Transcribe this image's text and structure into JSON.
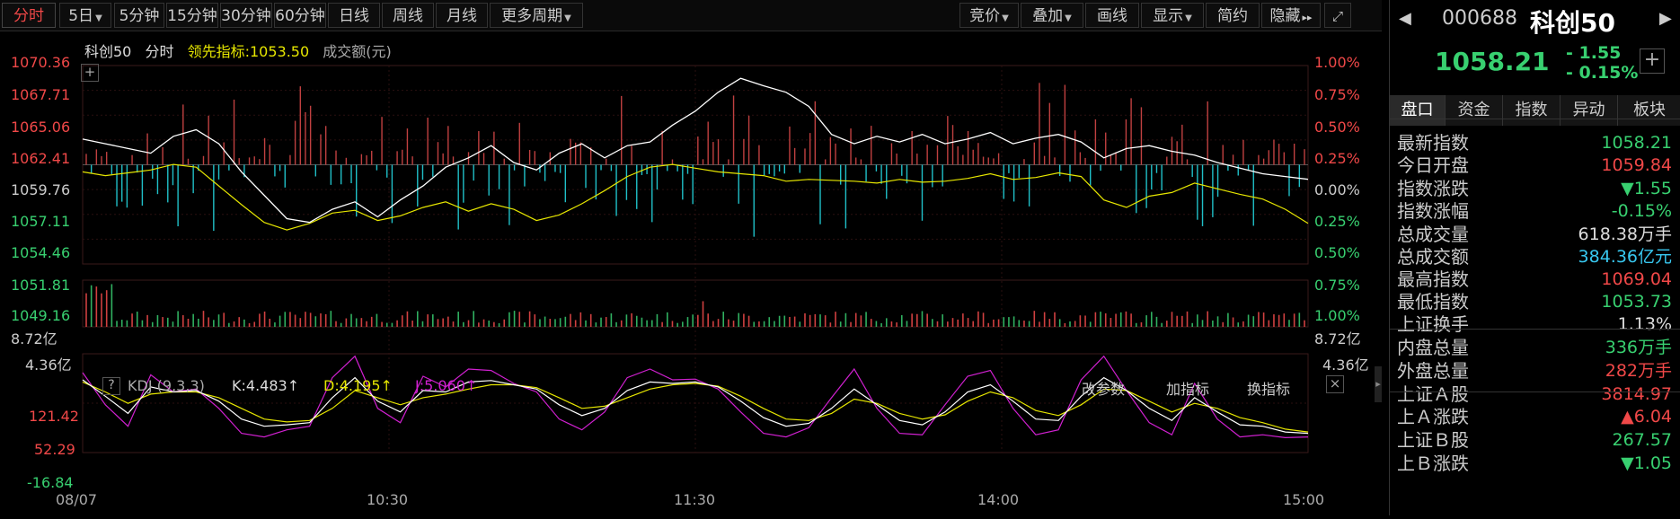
{
  "toolbar": {
    "periods": [
      "分时",
      "5日",
      "5分钟",
      "15分钟",
      "30分钟",
      "60分钟",
      "日线",
      "周线",
      "月线",
      "更多周期"
    ],
    "right": [
      "竞价",
      "叠加",
      "画线",
      "显示",
      "简约",
      "隐藏"
    ]
  },
  "chart_header": {
    "name": "科创50",
    "mode": "分时",
    "lead_label": "领先指标:1053.50",
    "volume_label": "成交额(元)"
  },
  "left_axis": [
    "1070.36",
    "1067.71",
    "1065.06",
    "1062.41",
    "1059.76",
    "1057.11",
    "1054.46",
    "1051.81",
    "1049.16"
  ],
  "right_axis": [
    "1.00%",
    "0.75%",
    "0.50%",
    "0.25%",
    "0.00%",
    "0.25%",
    "0.50%",
    "0.75%",
    "1.00%"
  ],
  "volume_axis": {
    "top": "8.72亿",
    "mid": "4.36亿"
  },
  "kdj": {
    "help": "?",
    "title": "KDJ (9,3,3)",
    "k": "K:4.483↑",
    "d": "D:4.195↑",
    "j": "J:5.060↑",
    "btn1": "改参数",
    "btn2": "加指标",
    "btn3": "换指标",
    "close": "×",
    "axis": [
      "121.42",
      "52.29",
      "-16.84"
    ]
  },
  "time_axis": [
    "08/07",
    "10:30",
    "11:30",
    "14:00",
    "15:00"
  ],
  "side": {
    "code": "000688",
    "name": "科创50",
    "price": "1058.21",
    "change": "- 1.55",
    "pct": "- 0.15%",
    "tabs": [
      "盘口",
      "资金",
      "指数",
      "异动",
      "板块"
    ],
    "rows": [
      {
        "k": "最新指数",
        "v": "1058.21",
        "c": "#38d070"
      },
      {
        "k": "今日开盘",
        "v": "1059.84",
        "c": "#f04848"
      },
      {
        "k": "指数涨跌",
        "v": "▼1.55",
        "c": "#38d070"
      },
      {
        "k": "指数涨幅",
        "v": "-0.15%",
        "c": "#38d070"
      },
      {
        "k": "总成交量",
        "v": "618.38万手",
        "c": "#dddddd"
      },
      {
        "k": "总成交额",
        "v": "384.36亿元",
        "c": "#38c8f0"
      },
      {
        "k": "最高指数",
        "v": "1069.04",
        "c": "#f04848"
      },
      {
        "k": "最低指数",
        "v": "1053.73",
        "c": "#38d070"
      },
      {
        "k": "上证换手",
        "v": "1.13%",
        "c": "#dddddd"
      },
      {
        "k": "内盘总量",
        "v": "336万手",
        "c": "#38d070"
      },
      {
        "k": "外盘总量",
        "v": "282万手",
        "c": "#f04848"
      },
      {
        "k": "上证Ａ股",
        "v": "3814.97",
        "c": "#f04848"
      },
      {
        "k": "上Ａ涨跌",
        "v": "▲6.04",
        "c": "#f04848"
      },
      {
        "k": "上证Ｂ股",
        "v": "267.57",
        "c": "#38d070"
      },
      {
        "k": "上Ｂ涨跌",
        "v": "▼1.05",
        "c": "#38d070"
      }
    ]
  },
  "colors": {
    "up": "#f04848",
    "down": "#38d070",
    "line": "#ffffff",
    "lead": "#e6e600",
    "jline": "#d020d0",
    "cyan": "#20c0c8"
  },
  "chart_data": {
    "type": "line",
    "x_labels": [
      "08/07",
      "10:30",
      "11:30",
      "14:00",
      "15:00"
    ],
    "price_range": [
      1049.16,
      1070.36
    ],
    "prev_close": 1059.76,
    "price_series": [
      1062.5,
      1062.0,
      1061.5,
      1061.0,
      1062.8,
      1063.5,
      1062.0,
      1059.0,
      1056.5,
      1054.0,
      1053.6,
      1055.0,
      1055.8,
      1054.2,
      1056.0,
      1057.5,
      1059.5,
      1060.5,
      1061.8,
      1060.0,
      1059.2,
      1061.0,
      1062.0,
      1060.5,
      1061.8,
      1062.2,
      1064.0,
      1065.5,
      1067.5,
      1069.0,
      1068.2,
      1067.5,
      1066.0,
      1063.0,
      1062.0,
      1062.8,
      1062.2,
      1063.0,
      1062.0,
      1062.5,
      1063.2,
      1062.0,
      1062.6,
      1063.0,
      1062.2,
      1060.5,
      1061.5,
      1061.8,
      1061.2,
      1060.8,
      1060.0,
      1059.4,
      1058.8,
      1058.5,
      1058.21
    ],
    "lead_series": [
      1059.0,
      1058.6,
      1058.9,
      1059.2,
      1059.8,
      1059.5,
      1057.5,
      1055.5,
      1053.6,
      1052.8,
      1053.5,
      1054.6,
      1054.9,
      1053.8,
      1054.3,
      1055.2,
      1055.8,
      1054.8,
      1055.6,
      1055.0,
      1053.8,
      1054.4,
      1055.6,
      1057.0,
      1058.5,
      1059.5,
      1059.8,
      1059.4,
      1059.0,
      1058.8,
      1058.6,
      1058.0,
      1058.2,
      1058.1,
      1058.0,
      1057.8,
      1058.2,
      1057.9,
      1058.0,
      1058.3,
      1058.8,
      1058.2,
      1058.4,
      1058.9,
      1058.5,
      1056.0,
      1055.2,
      1056.4,
      1056.8,
      1057.8,
      1057.2,
      1056.6,
      1056.1,
      1055.0,
      1053.5
    ],
    "kdj_range": [
      -16.84,
      121.42
    ],
    "k_series": [
      85,
      62,
      38,
      75,
      68,
      70,
      55,
      30,
      20,
      22,
      25,
      60,
      88,
      55,
      40,
      70,
      68,
      82,
      84,
      78,
      72,
      50,
      35,
      45,
      70,
      82,
      80,
      82,
      75,
      55,
      32,
      20,
      24,
      45,
      72,
      50,
      28,
      22,
      40,
      68,
      78,
      55,
      30,
      28,
      62,
      88,
      70,
      45,
      28,
      60,
      40,
      22,
      20,
      12,
      10
    ],
    "d_series": [
      82,
      68,
      52,
      65,
      68,
      68,
      60,
      45,
      30,
      26,
      28,
      45,
      70,
      60,
      50,
      60,
      65,
      72,
      78,
      78,
      74,
      60,
      45,
      48,
      60,
      72,
      78,
      80,
      76,
      62,
      45,
      30,
      28,
      38,
      58,
      52,
      38,
      30,
      36,
      55,
      68,
      60,
      42,
      35,
      50,
      72,
      70,
      55,
      40,
      52,
      45,
      32,
      25,
      16,
      12
    ],
    "j_series": [
      95,
      50,
      20,
      92,
      68,
      72,
      45,
      10,
      5,
      15,
      20,
      88,
      118,
      45,
      25,
      90,
      75,
      100,
      98,
      80,
      68,
      30,
      15,
      40,
      88,
      100,
      85,
      86,
      72,
      40,
      10,
      5,
      18,
      60,
      100,
      45,
      10,
      8,
      50,
      90,
      98,
      45,
      8,
      15,
      85,
      118,
      70,
      25,
      8,
      80,
      30,
      5,
      8,
      4,
      5
    ]
  }
}
